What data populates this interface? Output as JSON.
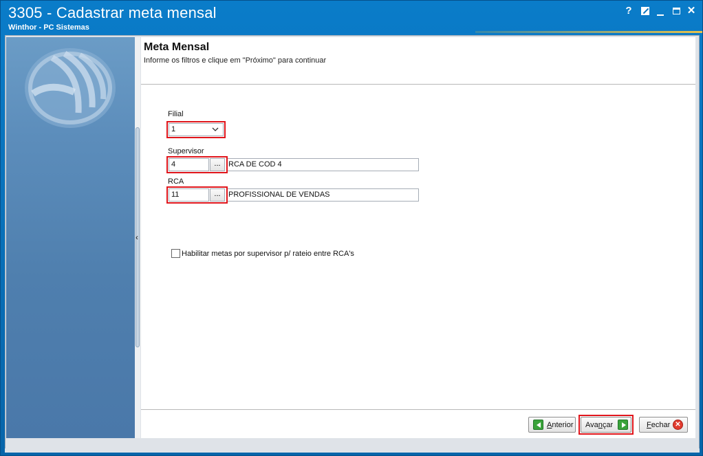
{
  "window": {
    "title": "3305 - Cadastrar meta mensal",
    "subtitle": "Winthor - PC Sistemas",
    "controls": {
      "help": "?",
      "close": "✕"
    }
  },
  "header": {
    "title": "Meta Mensal",
    "hint": "Informe os filtros e clique em \"Próximo\" para continuar"
  },
  "form": {
    "filial": {
      "label": "Filial",
      "value": "1"
    },
    "supervisor": {
      "label": "Supervisor",
      "code": "4",
      "button": "...",
      "description": "RCA DE COD 4"
    },
    "rca": {
      "label": "RCA",
      "code": "11",
      "button": "...",
      "description": "PROFISSIONAL DE VENDAS"
    },
    "checkbox": {
      "label": "Habilitar metas por supervisor p/ rateio entre RCA's",
      "checked": false
    }
  },
  "footer": {
    "anterior": {
      "first": "A",
      "rest": "nterior"
    },
    "avancar": {
      "pre": "Ava",
      "accel": "n",
      "post": "çar"
    },
    "fechar": {
      "first": "F",
      "rest": "echar"
    },
    "close_icon": "✕"
  },
  "icons": {
    "logo": "winthor-logo-icon",
    "anterior": "arrow-left-icon",
    "avancar": "arrow-right-icon",
    "fechar": "close-circle-icon"
  },
  "colors": {
    "titlebar": "#0a74bf",
    "highlight": "#e0151b",
    "sidepanel": "#5c8dbb"
  }
}
